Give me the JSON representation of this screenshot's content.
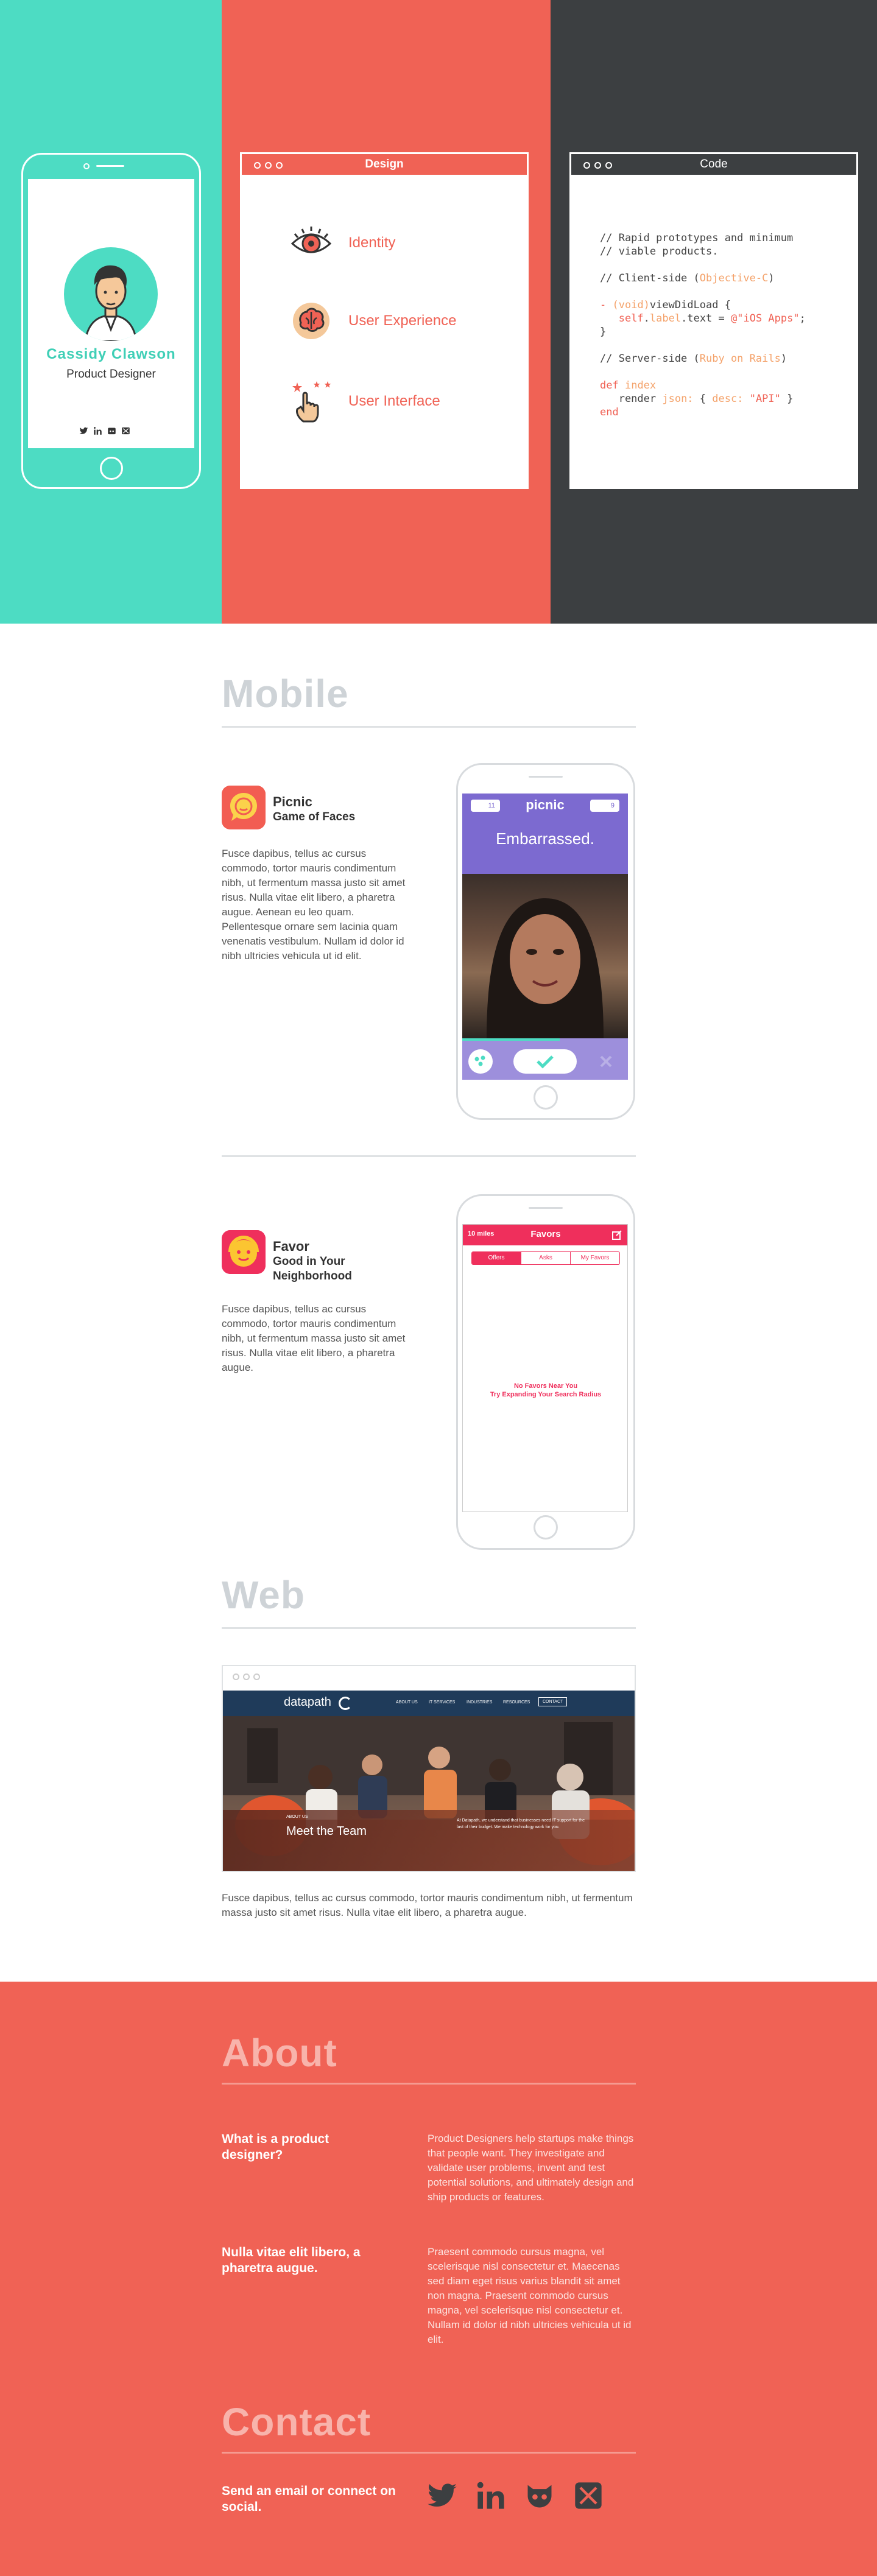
{
  "hero": {
    "card": {
      "name": "Cassidy Clawson",
      "role": "Product Designer"
    },
    "design_window": {
      "title": "Design",
      "items": [
        "Identity",
        "User Experience",
        "User Interface"
      ]
    },
    "code_window": {
      "title": "Code"
    }
  },
  "mobile": {
    "title": "Mobile",
    "apps": [
      {
        "name": "Picnic",
        "subtitle": "Game of Faces",
        "description": "Fusce dapibus, tellus ac cursus commodo, tortor mauris condimentum nibh, ut fermentum massa justo sit amet risus. Nulla vitae elit libero, a pharetra augue. Aenean eu leo quam. Pellentesque ornare sem lacinia quam venenatis vestibulum. Nullam id dolor id nibh ultricies vehicula ut id elit.",
        "screen": {
          "logo": "picnic",
          "left_badge": "11",
          "right_badge": "9",
          "prompt": "Embarrassed."
        }
      },
      {
        "name": "Favor",
        "subtitle": "Good in Your Neighborhood",
        "description": "Fusce dapibus, tellus ac cursus commodo, tortor mauris condimentum nibh, ut fermentum massa justo sit amet risus. Nulla vitae elit libero, a pharetra augue.",
        "screen": {
          "distance": "10 miles",
          "title": "Favors",
          "tabs": [
            "Offers",
            "Asks",
            "My Favors"
          ],
          "empty_line1": "No Favors Near You",
          "empty_line2": "Try Expanding Your Search Radius"
        }
      }
    ]
  },
  "web": {
    "title": "Web",
    "site": {
      "brand": "datapath",
      "nav": [
        "ABOUT US",
        "IT SERVICES",
        "INDUSTRIES",
        "RESOURCES",
        "CONTACT"
      ],
      "kicker": "ABOUT US",
      "headline": "Meet the Team",
      "caption": "At Datapath, we understand that businesses need IT support for the last of their budget. We make technology work for you."
    },
    "description": "Fusce dapibus, tellus ac cursus commodo, tortor mauris condimentum nibh, ut fermentum massa justo sit amet risus. Nulla vitae elit libero, a pharetra augue."
  },
  "about": {
    "title": "About",
    "qa": [
      {
        "q": "What is a product designer?",
        "a": "Product Designers help startups make things that people want. They investigate and validate user problems, invent and test potential solutions, and ultimately design and ship products or features."
      },
      {
        "q": "Nulla vitae elit libero, a pharetra augue.",
        "a": "Praesent commodo cursus magna, vel scelerisque nisl consectetur et. Maecenas sed diam eget risus varius blandit sit amet non magna. Praesent commodo cursus magna, vel scelerisque nisl consectetur et. Nullam id dolor id nibh ultricies vehicula ut id elit."
      }
    ]
  },
  "contact": {
    "title": "Contact",
    "prompt": "Send an email or connect on social.",
    "social": [
      "twitter-icon",
      "linkedin-icon",
      "github-icon",
      "email-icon"
    ]
  },
  "colors": {
    "teal": "#4ddcc3",
    "coral": "#f06255",
    "dark": "#3c3f41"
  }
}
